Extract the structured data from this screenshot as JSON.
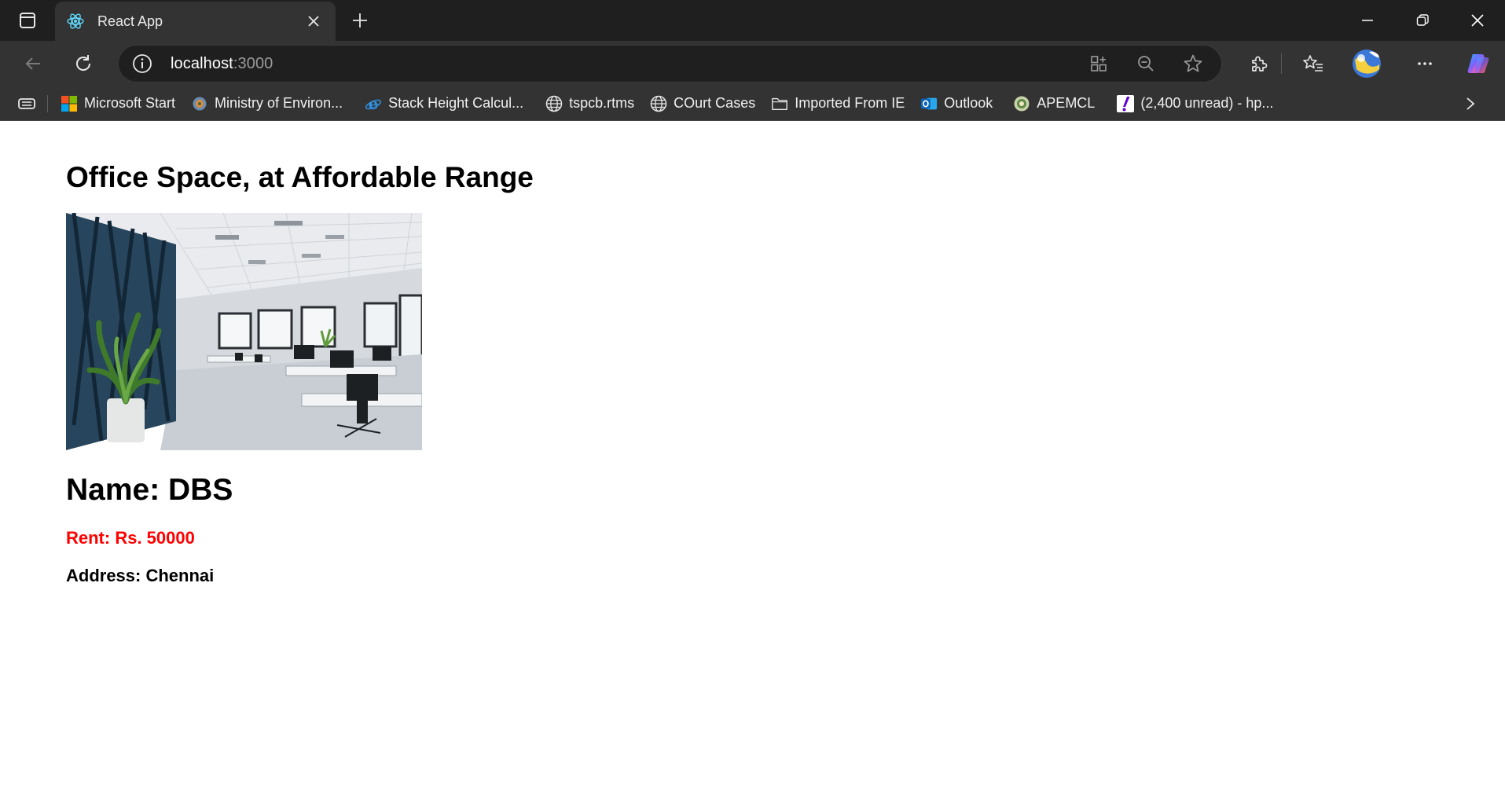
{
  "browser": {
    "tab_title": "React App",
    "address_host": "localhost",
    "address_port": ":3000",
    "bookmarks": [
      {
        "label": "Microsoft Start",
        "icon": "microsoft-logo-icon"
      },
      {
        "label": "Ministry of Environ...",
        "icon": "emblem-icon"
      },
      {
        "label": "Stack Height Calcul...",
        "icon": "ie-logo-icon"
      },
      {
        "label": "tspcb.rtms",
        "icon": "globe-icon"
      },
      {
        "label": "COurt Cases",
        "icon": "globe-icon"
      },
      {
        "label": "Imported From IE",
        "icon": "folder-icon"
      },
      {
        "label": "Outlook",
        "icon": "outlook-icon"
      },
      {
        "label": "APEMCL",
        "icon": "seal-icon"
      },
      {
        "label": "(2,400 unread) - hp...",
        "icon": "yahoo-mail-icon"
      }
    ]
  },
  "page": {
    "title": "Office Space, at Affordable Range",
    "name": "Name: DBS",
    "rent": "Rent: Rs. 50000",
    "address": "Address: Chennai",
    "rent_color": "#ff0000"
  }
}
